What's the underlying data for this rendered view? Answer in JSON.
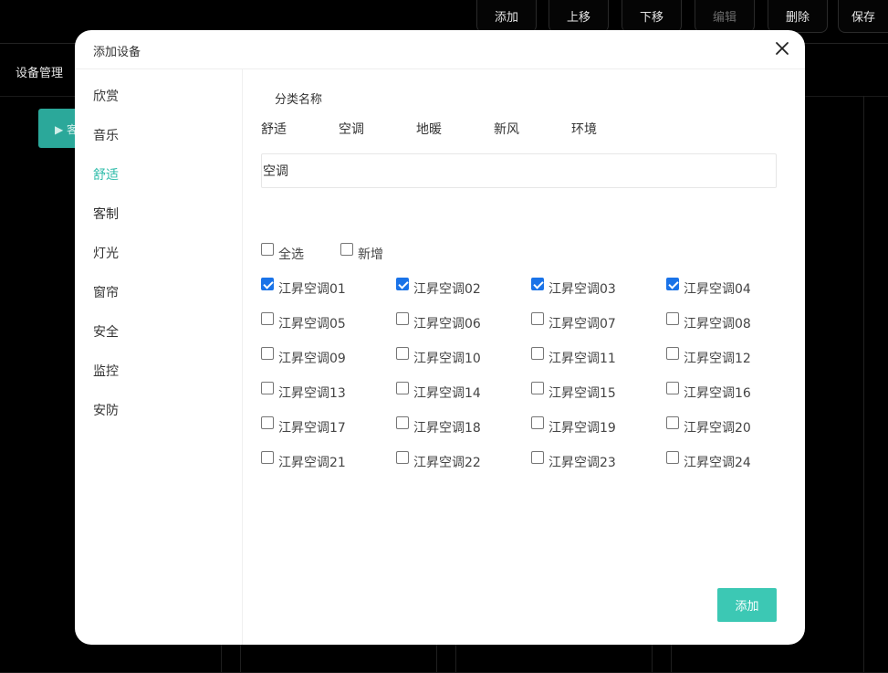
{
  "toolbar": {
    "buttons": [
      {
        "label": "添加"
      },
      {
        "label": "上移"
      },
      {
        "label": "下移"
      },
      {
        "label": "编辑"
      },
      {
        "label": "删除"
      },
      {
        "label": "保存"
      }
    ]
  },
  "app": {
    "title": "设备管理",
    "teal_button_label": "▶ 客"
  },
  "modal": {
    "title": "添加设备",
    "sidebar": [
      "欣赏",
      "音乐",
      "舒适",
      "客制",
      "灯光",
      "窗帘",
      "安全",
      "监控",
      "安防"
    ],
    "active_sidebar": "舒适",
    "section_label": "分类名称",
    "categories": [
      "舒适",
      "空调",
      "地暖",
      "新风",
      "环境"
    ],
    "input_value": "空调",
    "select_all_label": "全选",
    "new_label": "新增",
    "devices": [
      {
        "label": "江昇空调01",
        "checked": true
      },
      {
        "label": "江昇空调02",
        "checked": true
      },
      {
        "label": "江昇空调03",
        "checked": true
      },
      {
        "label": "江昇空调04",
        "checked": true
      },
      {
        "label": "江昇空调05",
        "checked": false
      },
      {
        "label": "江昇空调06",
        "checked": false
      },
      {
        "label": "江昇空调07",
        "checked": false
      },
      {
        "label": "江昇空调08",
        "checked": false
      },
      {
        "label": "江昇空调09",
        "checked": false
      },
      {
        "label": "江昇空调10",
        "checked": false
      },
      {
        "label": "江昇空调11",
        "checked": false
      },
      {
        "label": "江昇空调12",
        "checked": false
      },
      {
        "label": "江昇空调13",
        "checked": false
      },
      {
        "label": "江昇空调14",
        "checked": false
      },
      {
        "label": "江昇空调15",
        "checked": false
      },
      {
        "label": "江昇空调16",
        "checked": false
      },
      {
        "label": "江昇空调17",
        "checked": false
      },
      {
        "label": "江昇空调18",
        "checked": false
      },
      {
        "label": "江昇空调19",
        "checked": false
      },
      {
        "label": "江昇空调20",
        "checked": false
      },
      {
        "label": "江昇空调21",
        "checked": false
      },
      {
        "label": "江昇空调22",
        "checked": false
      },
      {
        "label": "江昇空调23",
        "checked": false
      },
      {
        "label": "江昇空调24",
        "checked": false
      }
    ],
    "add_button_label": "添加"
  },
  "colors": {
    "accent": "#3cc8b4",
    "active_text": "#2fbcaa",
    "checkbox_checked": "#1a73e8"
  }
}
